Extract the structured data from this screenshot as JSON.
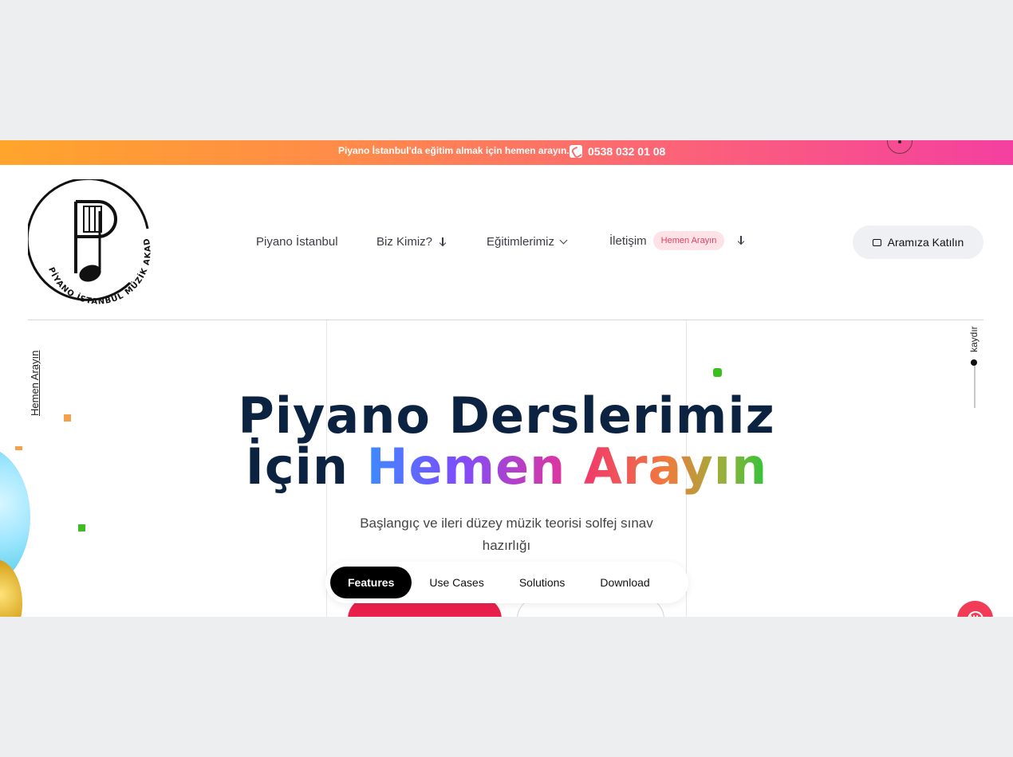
{
  "topbar": {
    "message": "Piyano İstanbul'da eğitim almak için hemen arayın.",
    "phone": "0538 032 01 08"
  },
  "logo": {
    "text": "PİYANO İSTANBUL MÜZİK AKADEMİ"
  },
  "nav": {
    "items": [
      {
        "label": "Piyano İstanbul"
      },
      {
        "label": "Biz Kimiz?"
      },
      {
        "label": "Eğitimlerimiz"
      },
      {
        "label": "İletişim"
      }
    ],
    "badge": "Hemen Arayın"
  },
  "cta": {
    "label": "Aramıza Katılın"
  },
  "side": {
    "left_label": "Hemen Arayın",
    "right_label": "kaydır"
  },
  "hero": {
    "line1": "Piyano Derslerimiz",
    "line2_prefix": "İçin ",
    "line2_highlight1": "Hemen",
    "line2_highlight2": "Arayın",
    "subtitle": "Başlangıç ve ileri düzey müzik teorisi solfej sınav hazırlığı"
  },
  "pill_nav": {
    "items": [
      "Features",
      "Use Cases",
      "Solutions",
      "Download"
    ],
    "active": "Features"
  },
  "colors": {
    "accent_red": "#ea1e4b",
    "dark_navy": "#0b2240",
    "chat": "#f23b57"
  }
}
